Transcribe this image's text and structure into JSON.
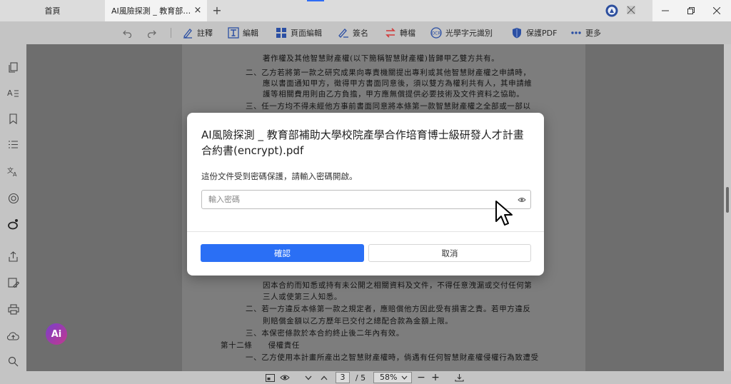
{
  "tabs": [
    {
      "label": "首頁"
    },
    {
      "label": "AI風險探測 _ 教育部補助大學校院產學合作培育博士級研發人才計畫合約書(encrypt).pdf"
    }
  ],
  "tab_new_label": "+",
  "tab_close_label": "×",
  "toolbar": {
    "annotate": "註釋",
    "edit": "編輯",
    "page_edit": "頁面編輯",
    "sign": "簽名",
    "convert": "轉檔",
    "ocr": "光學字元識別",
    "protect": "保護PDF",
    "more": "更多"
  },
  "document_lines_top": [
    "著作權及其他智慧財產權(以下簡稱智慧財產權)皆歸甲乙雙方共有。",
    "二、乙方若將第一款之研究成果向專責機關提出專利或其他智慧財產權之申請時，",
    "應以書面通知甲方，徵得甲方書面同意後，須以雙方為權利共有人，其申請維",
    "護等相關費用則由乙方負擔，甲方應無償提供必要技術及文件資料之協助。",
    "三、任一方均不得未經他方事前書面同意將本條第一款智慧財產權之全部或一部以"
  ],
  "document_lines_bottom": [
    "因本合約而知悉或持有未公開之相關資料及文件，不得任意洩漏或交付任何第",
    "三人或使第三人知悉。",
    "二、若一方違反本條第一款之規定者，應賠償他方因此受有損害之責。若甲方違反",
    "則賠償金額以乙方歷年已交付之總配合款為金額上限。",
    "三、本保密條款於本合約終止後二年內有效。",
    "第十二條　　侵權責任",
    "一、乙方使用本計畫所產出之智慧財產權時，倘遇有任何智慧財產權侵權行為致遭受"
  ],
  "dialog": {
    "title": "AI風險探測 _ 教育部補助大學校院產學合作培育博士級研發人才計畫合約書(encrypt).pdf",
    "message": "這份文件受到密碼保護，請輸入密碼開啟。",
    "password_value": "",
    "password_placeholder": "輸入密碼",
    "confirm_label": "確認",
    "cancel_label": "取消"
  },
  "bottombar": {
    "current_page": "3",
    "total_pages": "/ 5",
    "zoom": "58%",
    "zoom_out": "−",
    "zoom_in": "+"
  },
  "ai_button_label": "Ai",
  "colors": {
    "accent": "#2a6ff5",
    "ai_gradient_start": "#7a3fc9",
    "ai_gradient_end": "#c1398f"
  },
  "icons": [
    "undo-icon",
    "redo-icon",
    "pen-icon",
    "edit-text-icon",
    "grid-icon",
    "signature-icon",
    "convert-icon",
    "ocr-icon",
    "shield-icon",
    "more-dots-icon",
    "eye-icon"
  ]
}
